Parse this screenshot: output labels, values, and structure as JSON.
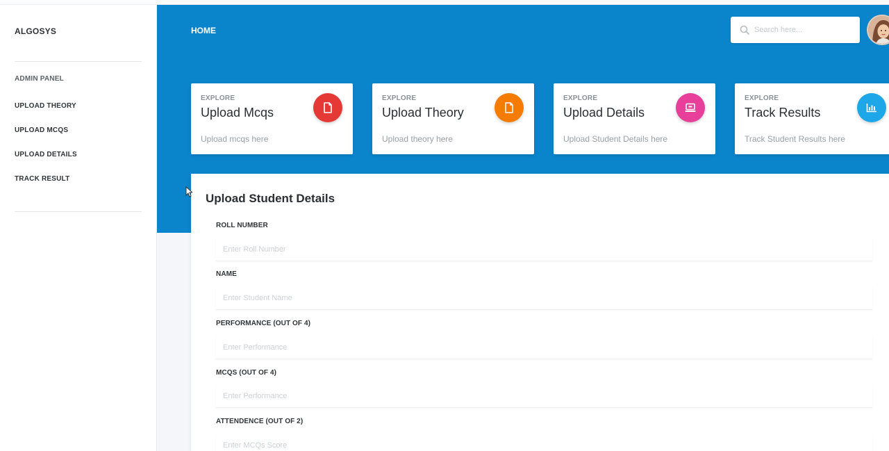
{
  "sidebar": {
    "brand": "ALGOSYS",
    "section_header": "ADMIN PANEL",
    "items": [
      {
        "label": "UPLOAD THEORY"
      },
      {
        "label": "UPLOAD MCQS"
      },
      {
        "label": "UPLOAD DETAILS"
      },
      {
        "label": "TRACK RESULT"
      }
    ]
  },
  "header": {
    "home_label": "HOME",
    "search_placeholder": "Search here..."
  },
  "cards": [
    {
      "eyebrow": "EXPLORE",
      "title": "Upload Mcqs",
      "subtitle": "Upload mcqs here",
      "icon": "document-icon",
      "color": "#e53935"
    },
    {
      "eyebrow": "EXPLORE",
      "title": "Upload Theory",
      "subtitle": "Upload theory here",
      "icon": "document-icon",
      "color": "#f57c00"
    },
    {
      "eyebrow": "EXPLORE",
      "title": "Upload Details",
      "subtitle": "Upload Student Details here",
      "icon": "laptop-icon",
      "color": "#e8409a"
    },
    {
      "eyebrow": "EXPLORE",
      "title": "Track Results",
      "subtitle": "Track Student Results here",
      "icon": "bar-chart-icon",
      "color": "#1ea7e8"
    }
  ],
  "form": {
    "title": "Upload Student Details",
    "fields": [
      {
        "label": "ROLL NUMBER",
        "placeholder": "Enter Roll Number",
        "value": ""
      },
      {
        "label": "NAME",
        "placeholder": "Enter Student Name",
        "value": ""
      },
      {
        "label": "PERFORMANCE (OUT OF 4)",
        "placeholder": "Enter Performance",
        "value": ""
      },
      {
        "label": "MCQS (OUT OF 4)",
        "placeholder": "Enter Performance",
        "value": ""
      },
      {
        "label": "ATTENDENCE (OUT OF 2)",
        "placeholder": "Enter MCQs Score",
        "value": ""
      }
    ]
  },
  "colors": {
    "hero_blue": "#0a85cc"
  }
}
